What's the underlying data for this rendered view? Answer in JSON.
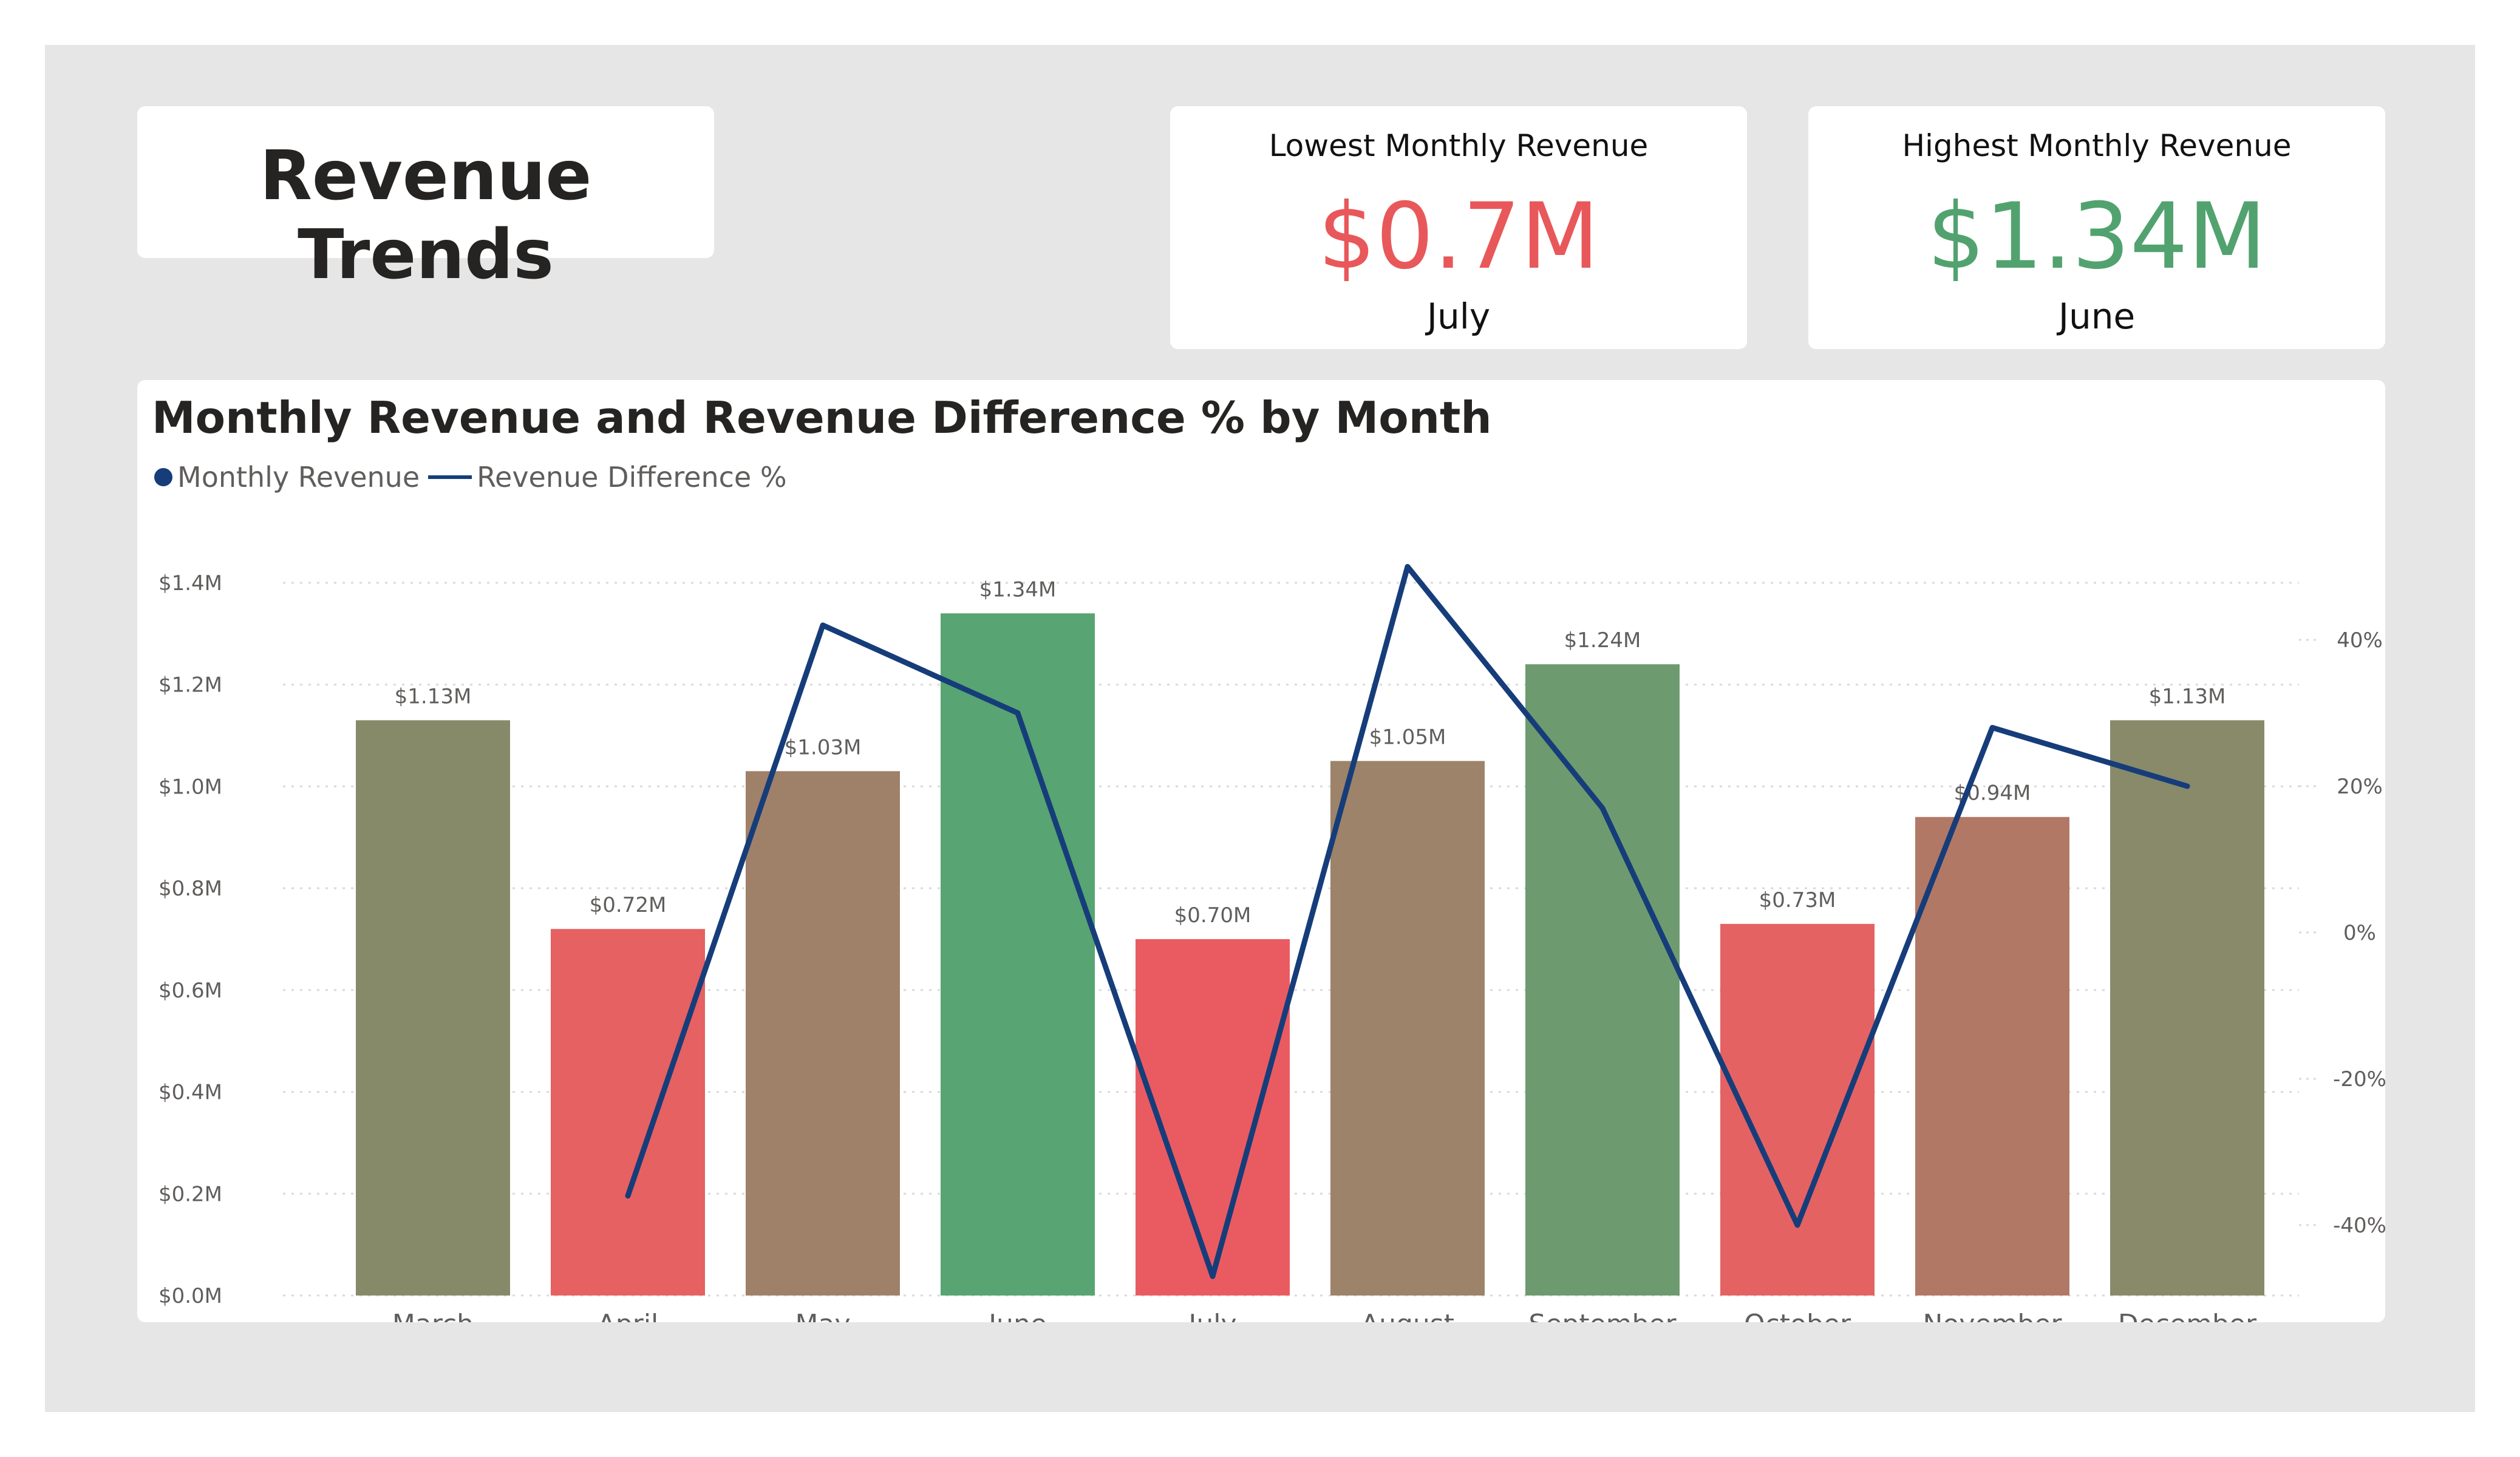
{
  "header": {
    "title": "Revenue Trends"
  },
  "kpis": {
    "lowest": {
      "label": "Lowest Monthly Revenue",
      "value": "$0.7M",
      "month": "July",
      "color": "#e8585a"
    },
    "highest": {
      "label": "Highest Monthly Revenue",
      "value": "$1.34M",
      "month": "June",
      "color": "#52a26f"
    }
  },
  "chart_data": {
    "type": "bar",
    "title": "Monthly Revenue and Revenue Difference % by Month",
    "legend": [
      "Monthly Revenue",
      "Revenue Difference %"
    ],
    "legend_position": "top-left",
    "grid": true,
    "categories": [
      "March",
      "April",
      "May",
      "June",
      "July",
      "August",
      "September",
      "October",
      "November",
      "December"
    ],
    "series": [
      {
        "name": "Monthly Revenue",
        "type": "bar",
        "axis": "left",
        "values": [
          1.13,
          0.72,
          1.03,
          1.34,
          0.7,
          1.05,
          1.24,
          0.73,
          0.94,
          1.13
        ],
        "labels": [
          "$1.13M",
          "$0.72M",
          "$1.03M",
          "$1.34M",
          "$0.70M",
          "$1.05M",
          "$1.24M",
          "$0.73M",
          "$0.94M",
          "$1.13M"
        ],
        "colors": [
          "#878a69",
          "#e66162",
          "#9f816a",
          "#58a472",
          "#ea5b61",
          "#9c8369",
          "#6e9a70",
          "#e56263",
          "#b27866",
          "#888a6a"
        ]
      },
      {
        "name": "Revenue Difference %",
        "type": "line",
        "axis": "right",
        "color": "#163d7a",
        "values": [
          null,
          -36,
          42,
          30,
          -47,
          50,
          17,
          -40,
          28,
          20
        ]
      }
    ],
    "y_left": {
      "ticks": [
        "$0.0M",
        "$0.2M",
        "$0.4M",
        "$0.6M",
        "$0.8M",
        "$1.0M",
        "$1.2M",
        "$1.4M"
      ],
      "range": [
        0,
        1.4
      ]
    },
    "y_right": {
      "ticks": [
        "-40%",
        "-20%",
        "0%",
        "20%",
        "40%"
      ]
    }
  }
}
